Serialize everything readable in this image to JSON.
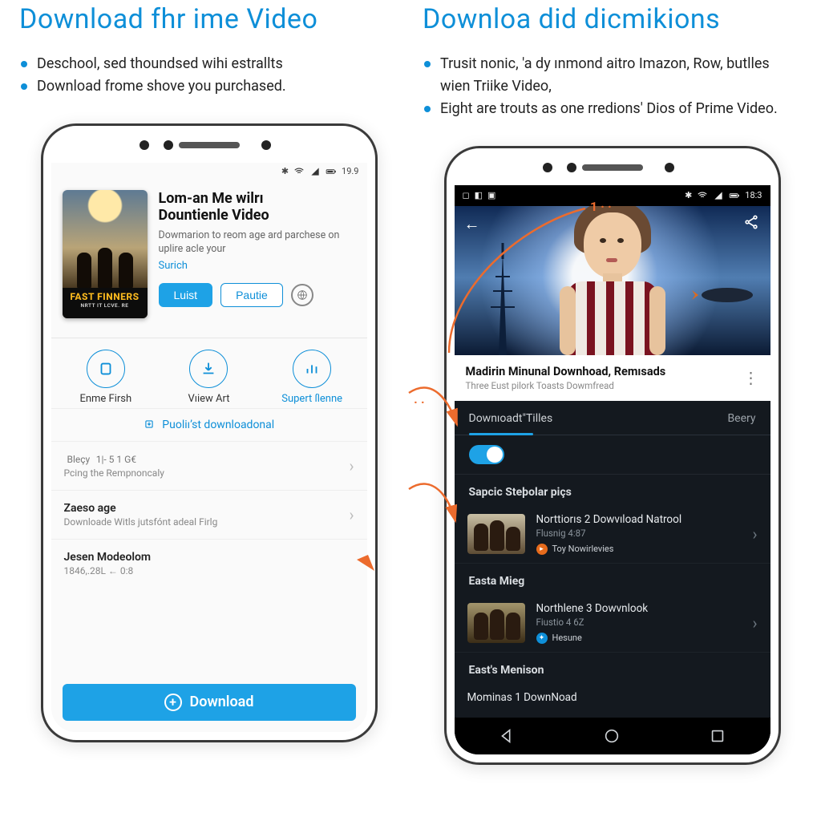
{
  "left": {
    "heading": "Download fhr ime Video",
    "bullets": [
      "Deschool, sed thoundsed wihi estrallts",
      "Download frome shove you purchased."
    ],
    "statusbar": {
      "time": "19.9",
      "battery_icon": "battery-icon",
      "wifi_icon": "wifi-icon",
      "cell_icon": "cell-icon"
    },
    "movie": {
      "title_line1": "Lom-an Me wilrı",
      "title_line2": "Dountienle Video",
      "desc": "Dowmarion to reom age ard parchese on uplire acle your",
      "link": "Surich",
      "poster_title": "FAST FINNERS",
      "poster_sub": "NRTT IT LCVE. RE"
    },
    "buttons": {
      "primary": "Luist",
      "secondary": "Pautie"
    },
    "circles": [
      {
        "icon": "download-icon",
        "label": "Enme Firsh"
      },
      {
        "icon": "download-circle-icon",
        "label": "Vıiew Art"
      },
      {
        "icon": "bars-icon",
        "label": "Supert ſlenne",
        "link": true
      }
    ],
    "middle_link": "Puoliı’st downloadonal",
    "rows": [
      {
        "title": "Bleçy",
        "meta": "1|- 5 1  G€",
        "sub": "Pcing the Rempnoncaly"
      },
      {
        "title": "Zaeso age",
        "meta": "",
        "sub": "Downloade Witls jutsfónt adeal Firlg"
      },
      {
        "title": "Jesen Modeolom",
        "meta": "",
        "sub": "1846,.28L ← 0:8"
      }
    ],
    "download_button": "Download"
  },
  "right": {
    "heading": "Downloa did dicmikions",
    "bullets": [
      "Trusit nonic, 'a dy ınmond aitro Imazon, Row, butlles wien Triike Video,",
      "Eight are trouts as one rredions' Dios of Prime Video."
    ],
    "statusbar": {
      "time": "18:3"
    },
    "hero": {
      "back_icon": "back-arrow-icon",
      "share_icon": "share-icon"
    },
    "card": {
      "title": "Madirin Minunal Downhoad, Remısads",
      "subtitle": "Тhree Eust pilork Toasts Dowmfread",
      "more_icon": "more-vert-icon"
    },
    "tabs": {
      "active": "Downıoadt\"Tilles",
      "right": "Beery"
    },
    "sections": [
      {
        "heading": "Sapcic Steþolar piçs",
        "rows": [
          {
            "t1": "Norttiorıs 2 Dowvıload Natrool",
            "t2": "Flusnig  4:87",
            "badge_label": "Тоу Nowirlevies",
            "badge_color": "orange"
          }
        ]
      },
      {
        "heading": "Easta Mieg",
        "rows": [
          {
            "t1": "Northlene 3 Dowvnlook",
            "t2": "Fiustio  4 6Z",
            "badge_label": "Hesune",
            "badge_color": "blue"
          }
        ]
      },
      {
        "heading": "East's Menison",
        "rows": [
          {
            "t1": "Mominas 1 DownNoad",
            "t2": "",
            "badge_label": "",
            "badge_color": ""
          }
        ]
      }
    ],
    "nav_icons": [
      "nav-back-icon",
      "nav-home-icon",
      "nav-recent-icon"
    ]
  },
  "annotations": {
    "step1": "1··",
    "step_mid": "··"
  }
}
